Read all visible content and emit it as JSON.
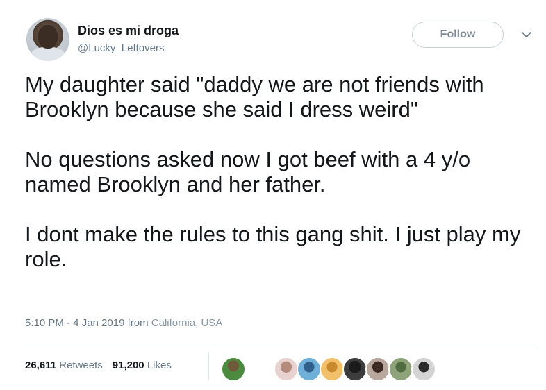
{
  "user": {
    "display_name": "Dios es mi droga",
    "handle": "@Lucky_Leftovers"
  },
  "follow_label": "Follow",
  "tweet": {
    "paragraphs": [
      "My daughter said \"daddy we are not friends with Brooklyn because she said I dress weird\"",
      "No questions asked now I got beef with a 4 y/o named Brooklyn and her father.",
      "I dont make the rules to this gang shit. I just play my role."
    ],
    "time": "5:10 PM - 4 Jan 2019",
    "from_word": "from",
    "location": "California, USA"
  },
  "stats": {
    "retweets_count": "26,611",
    "retweets_label": "Retweets",
    "likes_count": "91,200",
    "likes_label": "Likes"
  },
  "icons": [
    "user-avatar",
    "chevron-down-icon",
    "liker-avatars"
  ],
  "colors": {
    "text_primary": "#14171a",
    "text_secondary": "#657786",
    "border": "#e1e8ed"
  }
}
